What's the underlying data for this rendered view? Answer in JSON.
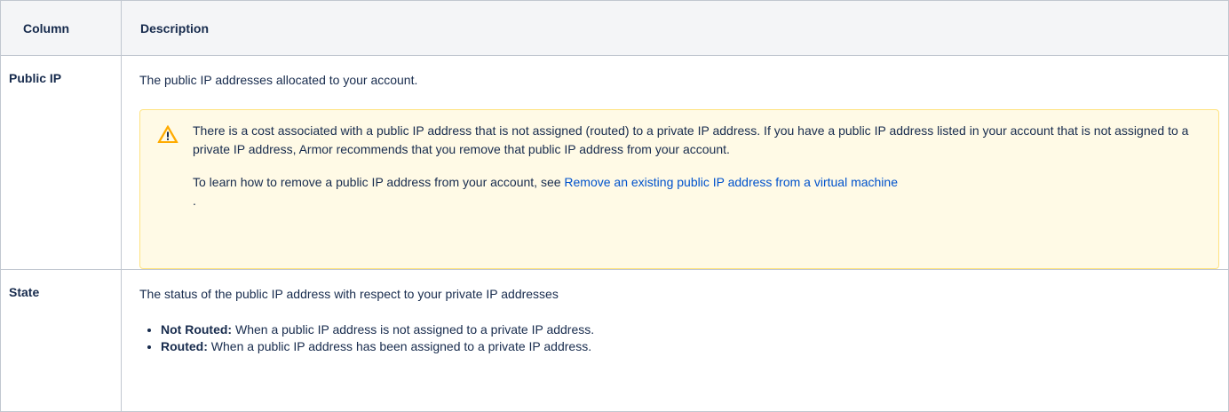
{
  "table": {
    "headers": [
      "Column",
      "Description"
    ],
    "rows": [
      {
        "column": "Public IP",
        "description": "The public IP addresses allocated to your account.",
        "warning": {
          "icon": "warning-icon",
          "paragraph1": "There is a cost associated with a public IP address that is not assigned (routed) to a private IP address. If you have a public IP address listed in your account that is not assigned to a private IP address, Armor recommends that you remove that public IP address from your account.",
          "paragraph2_prefix": "To learn how to remove a public IP address from your account, see ",
          "link_text": "Remove an existing public IP address from a virtual machine",
          "paragraph2_suffix": "."
        }
      },
      {
        "column": "State",
        "description": "The status of the public IP address with respect to your private IP addresses",
        "items": [
          {
            "term": "Not Routed:",
            "text": " When a public IP address is not assigned to a private IP address."
          },
          {
            "term": "Routed:",
            "text": " When a public IP address has been assigned to a private IP address."
          }
        ]
      }
    ]
  },
  "colors": {
    "border": "#c1c7d0",
    "header_bg": "#f4f5f7",
    "warning_bg": "#fffae6",
    "warning_border": "#ffe380",
    "link": "#0052cc"
  }
}
